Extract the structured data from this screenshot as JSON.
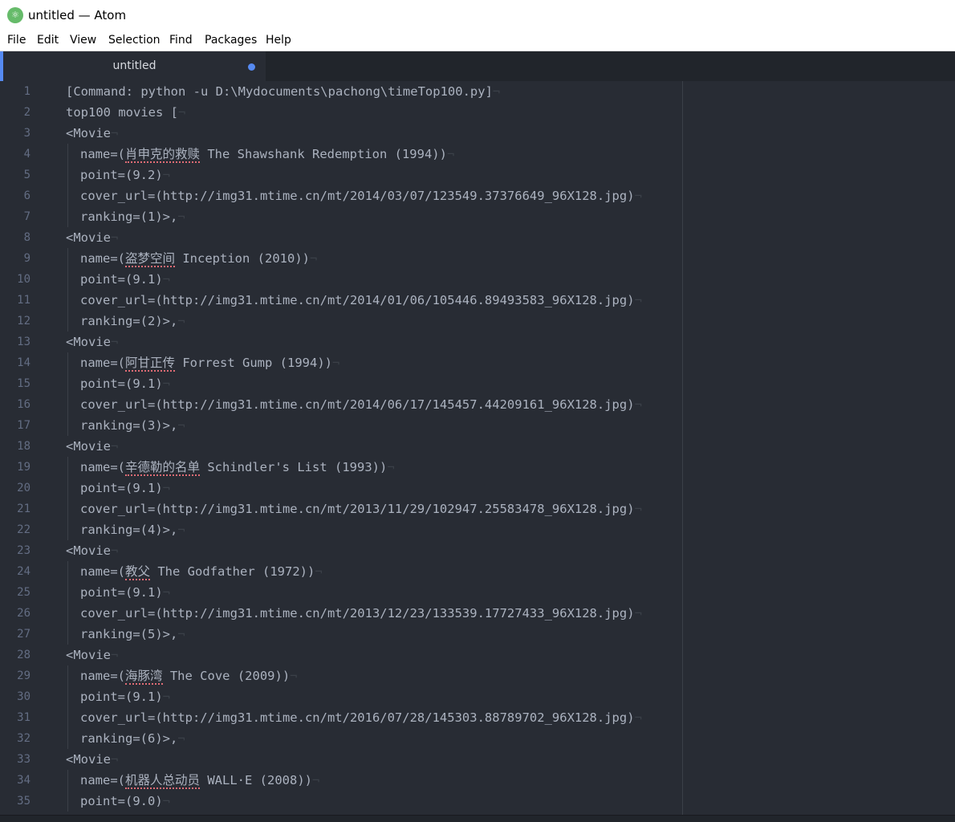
{
  "window": {
    "title": "untitled — Atom",
    "icon_glyph": "⚛"
  },
  "menu": [
    "File",
    "Edit",
    "View",
    "Selection",
    "Find",
    "Packages",
    "Help"
  ],
  "tab": {
    "label": "untitled",
    "modified": true
  },
  "colors": {
    "accent": "#568af2",
    "editor_bg": "#282c34",
    "text": "#abb2bf",
    "spell_error": "#e06c75"
  },
  "lines": [
    {
      "n": "1",
      "indent": false,
      "pre": "[Command: python -u D:\\Mydocuments\\pachong\\timeTop100.py]",
      "cjk": "",
      "post": ""
    },
    {
      "n": "2",
      "indent": false,
      "pre": "top100 movies [",
      "cjk": "",
      "post": ""
    },
    {
      "n": "3",
      "indent": false,
      "pre": "<Movie",
      "cjk": "",
      "post": ""
    },
    {
      "n": "4",
      "indent": true,
      "pre": "name=(",
      "cjk": "肖申克的救赎",
      "post": " The Shawshank Redemption (1994))"
    },
    {
      "n": "5",
      "indent": true,
      "pre": "point=(9.2)",
      "cjk": "",
      "post": ""
    },
    {
      "n": "6",
      "indent": true,
      "pre": "cover_url=(http://img31.mtime.cn/mt/2014/03/07/123549.37376649_96X128.jpg)",
      "cjk": "",
      "post": ""
    },
    {
      "n": "7",
      "indent": true,
      "pre": "ranking=(1)>,",
      "cjk": "",
      "post": ""
    },
    {
      "n": "8",
      "indent": false,
      "pre": "<Movie",
      "cjk": "",
      "post": ""
    },
    {
      "n": "9",
      "indent": true,
      "pre": "name=(",
      "cjk": "盗梦空间",
      "post": " Inception (2010))"
    },
    {
      "n": "10",
      "indent": true,
      "pre": "point=(9.1)",
      "cjk": "",
      "post": ""
    },
    {
      "n": "11",
      "indent": true,
      "pre": "cover_url=(http://img31.mtime.cn/mt/2014/01/06/105446.89493583_96X128.jpg)",
      "cjk": "",
      "post": ""
    },
    {
      "n": "12",
      "indent": true,
      "pre": "ranking=(2)>,",
      "cjk": "",
      "post": ""
    },
    {
      "n": "13",
      "indent": false,
      "pre": "<Movie",
      "cjk": "",
      "post": ""
    },
    {
      "n": "14",
      "indent": true,
      "pre": "name=(",
      "cjk": "阿甘正传",
      "post": " Forrest Gump (1994))"
    },
    {
      "n": "15",
      "indent": true,
      "pre": "point=(9.1)",
      "cjk": "",
      "post": ""
    },
    {
      "n": "16",
      "indent": true,
      "pre": "cover_url=(http://img31.mtime.cn/mt/2014/06/17/145457.44209161_96X128.jpg)",
      "cjk": "",
      "post": ""
    },
    {
      "n": "17",
      "indent": true,
      "pre": "ranking=(3)>,",
      "cjk": "",
      "post": ""
    },
    {
      "n": "18",
      "indent": false,
      "pre": "<Movie",
      "cjk": "",
      "post": ""
    },
    {
      "n": "19",
      "indent": true,
      "pre": "name=(",
      "cjk": "辛德勒的名单",
      "post": " Schindler's List (1993))"
    },
    {
      "n": "20",
      "indent": true,
      "pre": "point=(9.1)",
      "cjk": "",
      "post": ""
    },
    {
      "n": "21",
      "indent": true,
      "pre": "cover_url=(http://img31.mtime.cn/mt/2013/11/29/102947.25583478_96X128.jpg)",
      "cjk": "",
      "post": ""
    },
    {
      "n": "22",
      "indent": true,
      "pre": "ranking=(4)>,",
      "cjk": "",
      "post": ""
    },
    {
      "n": "23",
      "indent": false,
      "pre": "<Movie",
      "cjk": "",
      "post": ""
    },
    {
      "n": "24",
      "indent": true,
      "pre": "name=(",
      "cjk": "教父",
      "post": " The Godfather (1972))"
    },
    {
      "n": "25",
      "indent": true,
      "pre": "point=(9.1)",
      "cjk": "",
      "post": ""
    },
    {
      "n": "26",
      "indent": true,
      "pre": "cover_url=(http://img31.mtime.cn/mt/2013/12/23/133539.17727433_96X128.jpg)",
      "cjk": "",
      "post": ""
    },
    {
      "n": "27",
      "indent": true,
      "pre": "ranking=(5)>,",
      "cjk": "",
      "post": ""
    },
    {
      "n": "28",
      "indent": false,
      "pre": "<Movie",
      "cjk": "",
      "post": ""
    },
    {
      "n": "29",
      "indent": true,
      "pre": "name=(",
      "cjk": "海豚湾",
      "post": " The Cove (2009))"
    },
    {
      "n": "30",
      "indent": true,
      "pre": "point=(9.1)",
      "cjk": "",
      "post": ""
    },
    {
      "n": "31",
      "indent": true,
      "pre": "cover_url=(http://img31.mtime.cn/mt/2016/07/28/145303.88789702_96X128.jpg)",
      "cjk": "",
      "post": ""
    },
    {
      "n": "32",
      "indent": true,
      "pre": "ranking=(6)>,",
      "cjk": "",
      "post": ""
    },
    {
      "n": "33",
      "indent": false,
      "pre": "<Movie",
      "cjk": "",
      "post": ""
    },
    {
      "n": "34",
      "indent": true,
      "pre": "name=(",
      "cjk": "机器人总动员",
      "post": " WALL·E (2008))"
    },
    {
      "n": "35",
      "indent": true,
      "pre": "point=(9.0)",
      "cjk": "",
      "post": ""
    }
  ]
}
